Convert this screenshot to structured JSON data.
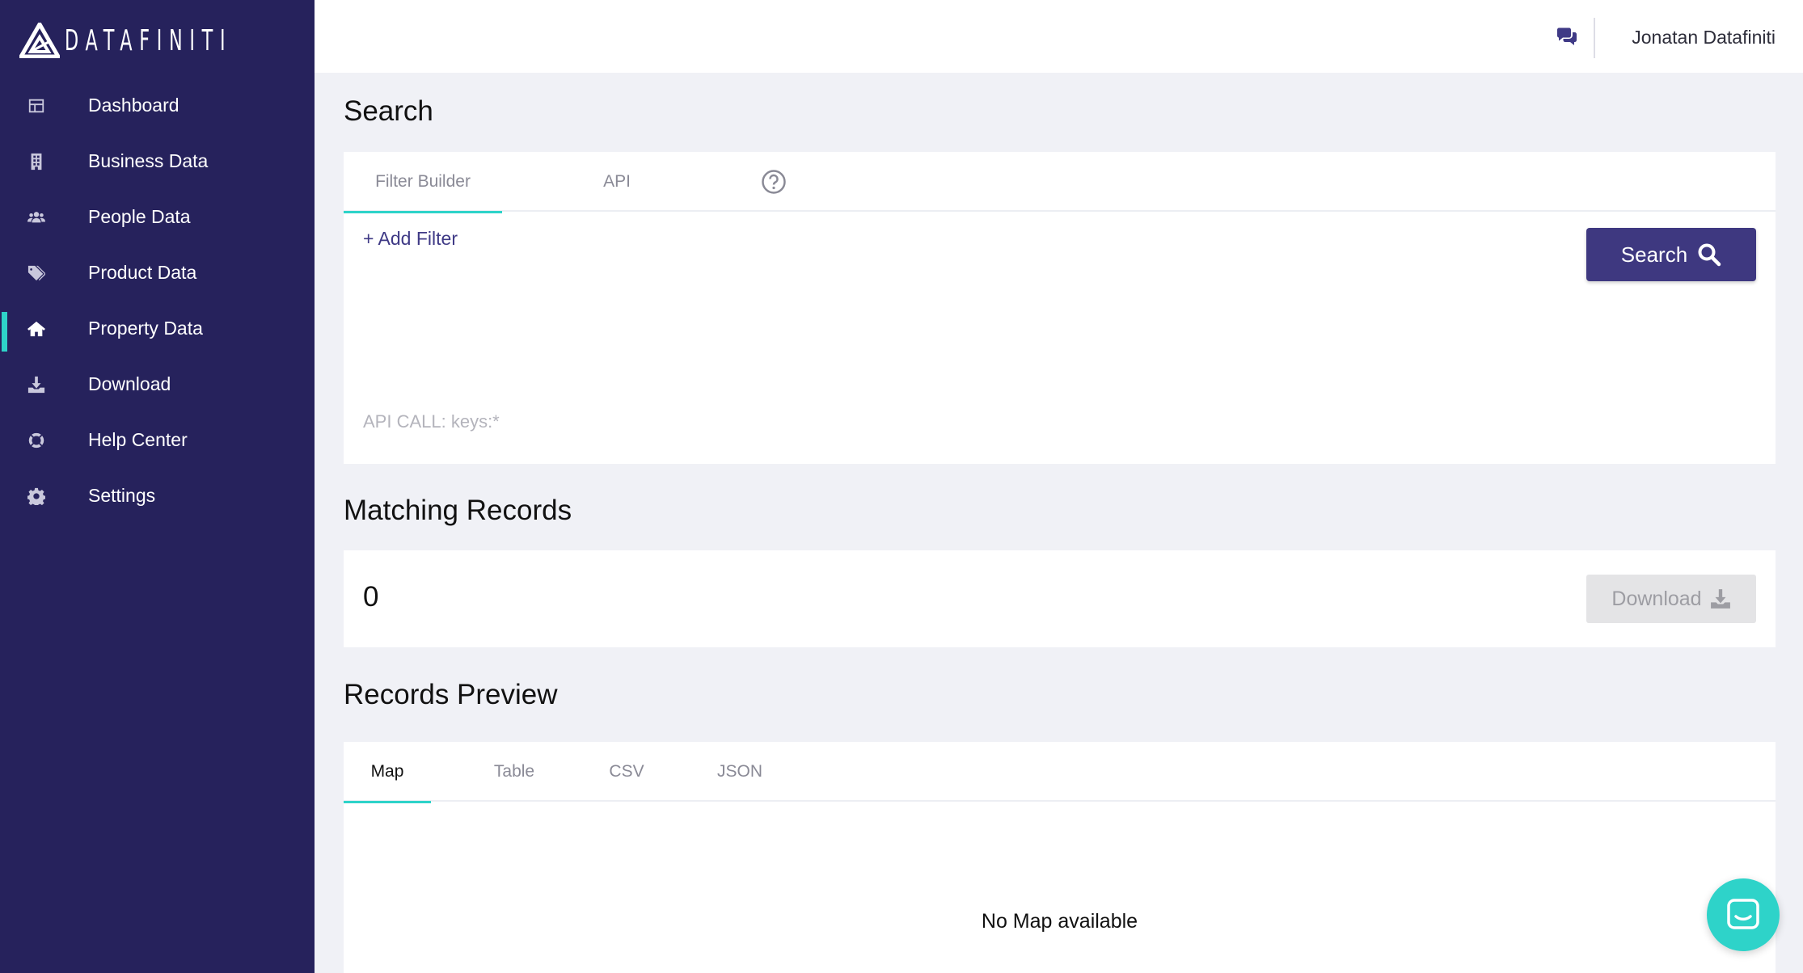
{
  "brand": {
    "name": "DATAFINITI",
    "accent": "#2ed3c9",
    "sidebar_bg": "#26225c",
    "primary": "#3e3880"
  },
  "sidebar": {
    "items": [
      {
        "label": "Dashboard",
        "icon": "dashboard-icon"
      },
      {
        "label": "Business Data",
        "icon": "building-icon"
      },
      {
        "label": "People Data",
        "icon": "people-icon"
      },
      {
        "label": "Product Data",
        "icon": "tags-icon"
      },
      {
        "label": "Property Data",
        "icon": "home-icon",
        "active": true
      },
      {
        "label": "Download",
        "icon": "download-icon"
      },
      {
        "label": "Help Center",
        "icon": "lifebuoy-icon"
      },
      {
        "label": "Settings",
        "icon": "gear-icon"
      }
    ]
  },
  "header": {
    "user_name": "Jonatan Datafiniti",
    "chat_icon": "chat-icon"
  },
  "search": {
    "title": "Search",
    "tabs": [
      {
        "label": "Filter Builder",
        "active": true
      },
      {
        "label": "API",
        "active": false
      }
    ],
    "add_filter_label": "+ Add Filter",
    "search_button_label": "Search",
    "api_call": "API CALL: keys:*"
  },
  "matching": {
    "title": "Matching Records",
    "count": "0",
    "download_label": "Download"
  },
  "preview": {
    "title": "Records Preview",
    "tabs": [
      {
        "label": "Map",
        "active": true
      },
      {
        "label": "Table",
        "active": false
      },
      {
        "label": "CSV",
        "active": false
      },
      {
        "label": "JSON",
        "active": false
      }
    ],
    "empty_message": "No Map available"
  }
}
